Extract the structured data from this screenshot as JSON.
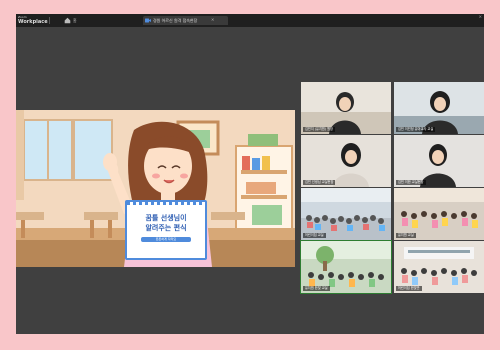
{
  "window": {
    "brand_small": "Zoom",
    "brand_large": "Workplace",
    "tab_home": "홈",
    "tab_meeting": "경원 어르신 원격 접속현장",
    "close_label": "×"
  },
  "participants": [
    {
      "name": "김민지 (유치원) 원장",
      "mic": "🎤"
    },
    {
      "name": "김민 이민정 유아교사 교실",
      "mic": "🎤"
    },
    {
      "name": "김민 선생님 교실현장",
      "mic": "🎤"
    },
    {
      "name": "김민 이한 교실현장",
      "mic": "🎤"
    },
    {
      "name": "어린이집 교실",
      "mic": "🎤"
    },
    {
      "name": "유치원 교실",
      "mic": "🎤"
    },
    {
      "name": "유치원 한빛 교실",
      "mic": "🎤"
    },
    {
      "name": "어린이집 한빛반",
      "mic": "🎤"
    }
  ],
  "presentation": {
    "sign_line1": "꿈틀 선생님이",
    "sign_line2": "알려주는 편식",
    "sign_footer": "튼튼하게 자라요"
  },
  "colors": {
    "outer_bg": "#f9c6c9",
    "accent": "#2e7d32"
  }
}
